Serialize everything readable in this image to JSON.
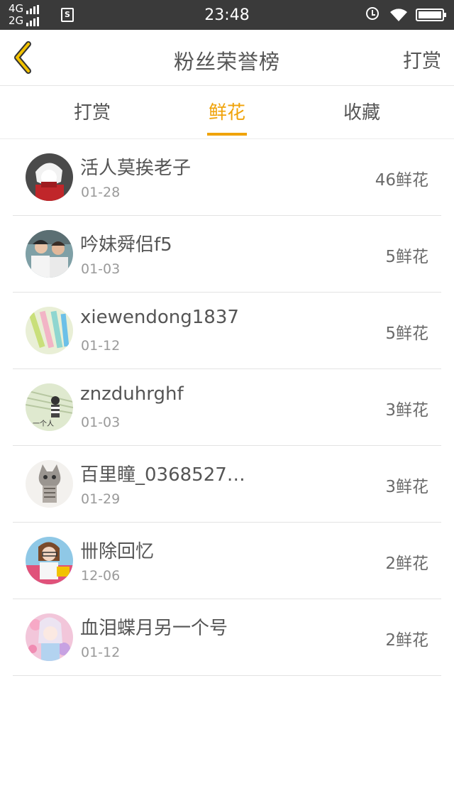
{
  "status_bar": {
    "network_top": "4G",
    "network_bottom": "2G",
    "sim_badge": "S",
    "time": "23:48"
  },
  "header": {
    "title": "粉丝荣誉榜",
    "right_action": "打赏"
  },
  "tabs": [
    {
      "label": "打赏",
      "active": false
    },
    {
      "label": "鲜花",
      "active": true
    },
    {
      "label": "收藏",
      "active": false
    }
  ],
  "colors": {
    "accent": "#f0a30a",
    "status_bar": "#3a3a3a"
  },
  "fans": [
    {
      "name": "活人莫挨老子",
      "date": "01-28",
      "count": "46鲜花",
      "avatar": "anime-avatar-red"
    },
    {
      "name": "吟妹舜侣f5",
      "date": "01-03",
      "count": "5鲜花",
      "avatar": "couple-photo-avatar"
    },
    {
      "name": "xiewendong1837",
      "date": "01-12",
      "count": "5鲜花",
      "avatar": "pens-avatar"
    },
    {
      "name": "znzduhrghf",
      "date": "01-03",
      "count": "3鲜花",
      "avatar": "sketch-avatar"
    },
    {
      "name": "百里瞳_0368527…",
      "date": "01-29",
      "count": "3鲜花",
      "avatar": "kitten-avatar"
    },
    {
      "name": "卌除回忆",
      "date": "12-06",
      "count": "2鲜花",
      "avatar": "girl-photo-avatar"
    },
    {
      "name": "血泪蝶月另一个号",
      "date": "01-12",
      "count": "2鲜花",
      "avatar": "anime-girl-avatar"
    }
  ]
}
